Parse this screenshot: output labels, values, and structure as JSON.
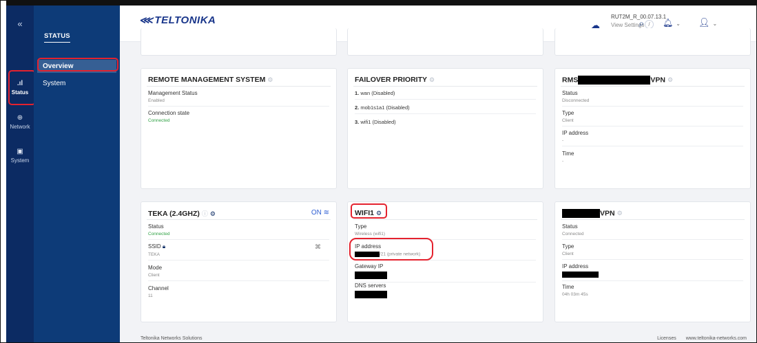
{
  "nav_primary": {
    "collapse_icon": "«",
    "items": [
      {
        "label": "Status",
        "icon": "signal-icon",
        "glyph": ".ıl"
      },
      {
        "label": "Network",
        "icon": "globe-icon",
        "glyph": "⊕"
      },
      {
        "label": "System",
        "icon": "system-icon",
        "glyph": "▣"
      }
    ]
  },
  "nav_secondary": {
    "title": "STATUS",
    "items": [
      {
        "label": "Overview"
      },
      {
        "label": "System"
      }
    ]
  },
  "header": {
    "logo_text": "TELTONIKA",
    "search_shortcut": "/",
    "version": "RUT2M_R_00.07.13.1",
    "view_settings": "View Settings"
  },
  "cards": {
    "rms": {
      "title": "REMOTE MANAGEMENT SYSTEM",
      "fields": [
        {
          "label": "Management Status",
          "value": "Enabled"
        },
        {
          "label": "Connection state",
          "value": "Connected"
        }
      ]
    },
    "failover": {
      "title": "FAILOVER PRIORITY",
      "items": [
        {
          "num": "1.",
          "text": "wan (Disabled)"
        },
        {
          "num": "2.",
          "text": "mob1s1a1 (Disabled)"
        },
        {
          "num": "3.",
          "text": "wifi1 (Disabled)"
        }
      ]
    },
    "rms_vpn": {
      "title_prefix": "RMS",
      "title_suffix": "VPN",
      "fields": [
        {
          "label": "Status",
          "value": "Disconnected"
        },
        {
          "label": "Type",
          "value": "Client"
        },
        {
          "label": "IP address",
          "value": "-"
        },
        {
          "label": "Time",
          "value": "-"
        }
      ]
    },
    "teka": {
      "title": "TEKA (2.4GHZ)",
      "toggle": "ON",
      "fields": [
        {
          "label": "Status",
          "value": "Connected"
        },
        {
          "label": "SSID",
          "value": "TEKA"
        },
        {
          "label": "Mode",
          "value": "Client"
        },
        {
          "label": "Channel",
          "value": "11"
        }
      ]
    },
    "wifi1": {
      "title": "WIFI1",
      "fields": [
        {
          "label": "Type",
          "value": "Wireless (wifi1)"
        },
        {
          "label": "IP address",
          "value_suffix": "/21 (private network)"
        },
        {
          "label": "Gateway IP"
        },
        {
          "label": "DNS servers"
        }
      ]
    },
    "vpn": {
      "title_suffix": "VPN",
      "fields": [
        {
          "label": "Status",
          "value": "Connected"
        },
        {
          "label": "Type",
          "value": "Client"
        },
        {
          "label": "IP address"
        },
        {
          "label": "Time",
          "value": "04h 03m 45s"
        }
      ]
    }
  },
  "footer": {
    "left": "Teltonika Networks Solutions",
    "licenses": "Licenses",
    "site": "www.teltonika-networks.com"
  },
  "colors": {
    "nav_dark": "#0c2b63",
    "nav": "#0d3b78",
    "highlight": "#e4222e",
    "green": "#2ea043"
  }
}
